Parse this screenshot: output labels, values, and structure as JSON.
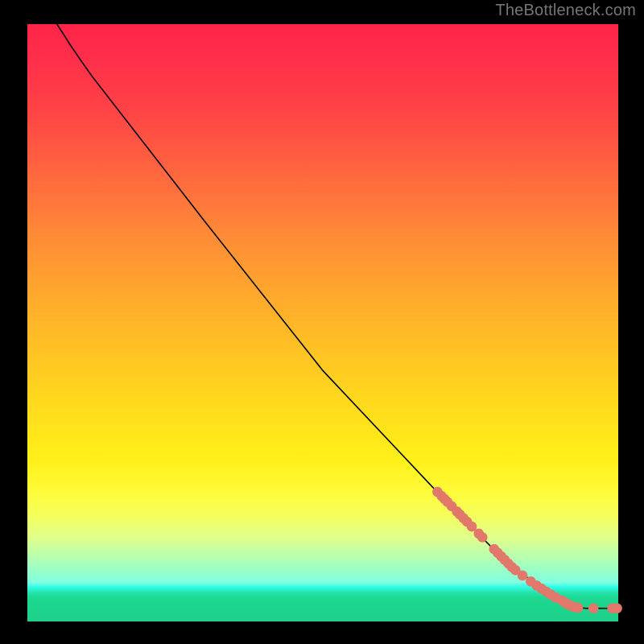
{
  "attribution": "TheBottleneck.com",
  "colors": {
    "marker_fill": "#e1786b",
    "curve": "#000000"
  },
  "chart_data": {
    "type": "line",
    "title": "",
    "xlabel": "",
    "ylabel": "",
    "xlim": [
      0,
      1
    ],
    "ylim": [
      0,
      1
    ],
    "curve": [
      {
        "x": 0.05,
        "y": 1.0
      },
      {
        "x": 0.06,
        "y": 0.985
      },
      {
        "x": 0.072,
        "y": 0.966
      },
      {
        "x": 0.09,
        "y": 0.94
      },
      {
        "x": 0.11,
        "y": 0.912
      },
      {
        "x": 0.3,
        "y": 0.67
      },
      {
        "x": 0.5,
        "y": 0.42
      },
      {
        "x": 0.7,
        "y": 0.21
      },
      {
        "x": 0.8,
        "y": 0.11
      },
      {
        "x": 0.87,
        "y": 0.055
      },
      {
        "x": 0.905,
        "y": 0.035
      },
      {
        "x": 0.926,
        "y": 0.024
      },
      {
        "x": 0.945,
        "y": 0.022
      },
      {
        "x": 0.97,
        "y": 0.022
      },
      {
        "x": 1.0,
        "y": 0.022
      }
    ],
    "markers": [
      {
        "x": 0.694,
        "y": 0.217
      },
      {
        "x": 0.701,
        "y": 0.21
      },
      {
        "x": 0.706,
        "y": 0.205
      },
      {
        "x": 0.711,
        "y": 0.2
      },
      {
        "x": 0.718,
        "y": 0.193
      },
      {
        "x": 0.727,
        "y": 0.184
      },
      {
        "x": 0.732,
        "y": 0.179
      },
      {
        "x": 0.738,
        "y": 0.173
      },
      {
        "x": 0.744,
        "y": 0.167
      },
      {
        "x": 0.752,
        "y": 0.159
      },
      {
        "x": 0.764,
        "y": 0.147
      },
      {
        "x": 0.77,
        "y": 0.141
      },
      {
        "x": 0.79,
        "y": 0.121
      },
      {
        "x": 0.796,
        "y": 0.115
      },
      {
        "x": 0.802,
        "y": 0.109
      },
      {
        "x": 0.808,
        "y": 0.103
      },
      {
        "x": 0.814,
        "y": 0.097
      },
      {
        "x": 0.82,
        "y": 0.091
      },
      {
        "x": 0.826,
        "y": 0.086
      },
      {
        "x": 0.838,
        "y": 0.077
      },
      {
        "x": 0.852,
        "y": 0.067
      },
      {
        "x": 0.862,
        "y": 0.06
      },
      {
        "x": 0.87,
        "y": 0.055
      },
      {
        "x": 0.878,
        "y": 0.05
      },
      {
        "x": 0.886,
        "y": 0.045
      },
      {
        "x": 0.894,
        "y": 0.04
      },
      {
        "x": 0.905,
        "y": 0.035
      },
      {
        "x": 0.911,
        "y": 0.031
      },
      {
        "x": 0.916,
        "y": 0.028
      },
      {
        "x": 0.921,
        "y": 0.026
      },
      {
        "x": 0.926,
        "y": 0.024
      },
      {
        "x": 0.932,
        "y": 0.023
      },
      {
        "x": 0.958,
        "y": 0.022
      },
      {
        "x": 0.99,
        "y": 0.022
      },
      {
        "x": 0.998,
        "y": 0.022
      }
    ]
  }
}
